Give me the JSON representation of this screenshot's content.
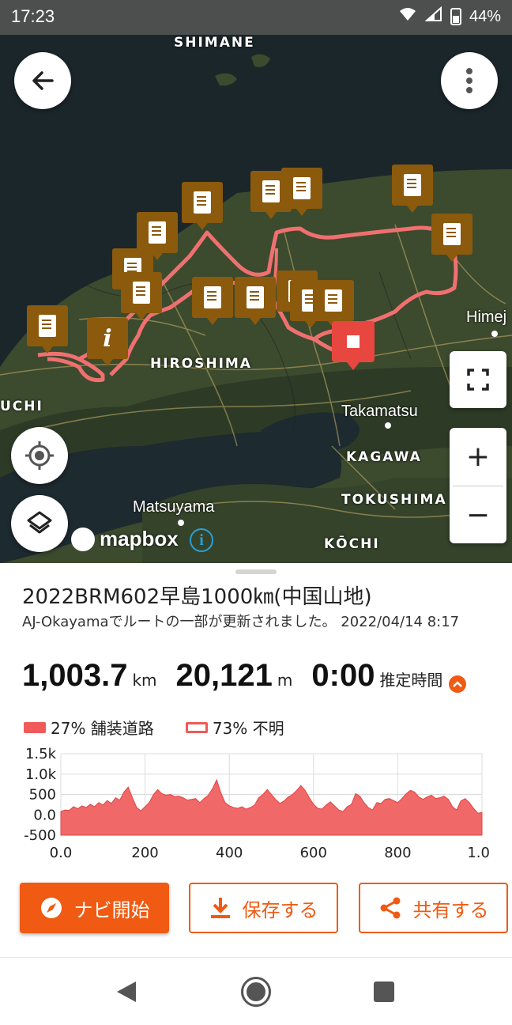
{
  "status_bar": {
    "time": "17:23",
    "battery": "44%"
  },
  "map": {
    "region_labels": {
      "shimane": "SHIMANE",
      "hiroshima": "HIROSHIMA",
      "uchi": "UCHI",
      "kagawa": "KAGAWA",
      "tokushima": "TOKUSHIMA",
      "kochi": "KŌCHI"
    },
    "city_labels": {
      "himeji": "Himej",
      "takamatsu": "Takamatsu",
      "matsuyama": "Matsuyama"
    },
    "attribution": "mapbox",
    "route_color": "#f07070",
    "marker_color": "#8b5a0d",
    "goal_color": "#e8473f",
    "buttons": {
      "zoom_in": "+",
      "zoom_out": "−"
    }
  },
  "route": {
    "title": "2022BRM602早島1000㎞(中国山地)",
    "update_note": "AJ-Okayamaでルートの一部が更新されました。 2022/04/14 8:17",
    "distance_value": "1,003.7",
    "distance_unit": "km",
    "elevation_value": "20,121",
    "elevation_unit": "m",
    "time_value": "0:00",
    "time_label": "推定時間"
  },
  "legend": {
    "paved": "27% 舗装道路",
    "unknown": "73% 不明"
  },
  "chart_data": {
    "type": "area",
    "series": [
      {
        "values": [
          [
            0,
            80
          ],
          [
            10,
            120
          ],
          [
            20,
            110
          ],
          [
            30,
            200
          ],
          [
            40,
            150
          ],
          [
            50,
            220
          ],
          [
            60,
            180
          ],
          [
            70,
            260
          ],
          [
            80,
            200
          ],
          [
            90,
            300
          ],
          [
            100,
            240
          ],
          [
            110,
            350
          ],
          [
            120,
            280
          ],
          [
            130,
            420
          ],
          [
            140,
            360
          ],
          [
            150,
            560
          ],
          [
            160,
            680
          ],
          [
            170,
            420
          ],
          [
            180,
            180
          ],
          [
            190,
            100
          ],
          [
            200,
            200
          ],
          [
            210,
            300
          ],
          [
            220,
            500
          ],
          [
            230,
            620
          ],
          [
            240,
            520
          ],
          [
            250,
            480
          ],
          [
            260,
            500
          ],
          [
            270,
            450
          ],
          [
            280,
            460
          ],
          [
            290,
            420
          ],
          [
            300,
            360
          ],
          [
            310,
            380
          ],
          [
            320,
            400
          ],
          [
            330,
            300
          ],
          [
            340,
            400
          ],
          [
            350,
            480
          ],
          [
            360,
            640
          ],
          [
            370,
            860
          ],
          [
            380,
            540
          ],
          [
            390,
            300
          ],
          [
            400,
            220
          ],
          [
            410,
            180
          ],
          [
            420,
            160
          ],
          [
            430,
            200
          ],
          [
            440,
            140
          ],
          [
            450,
            180
          ],
          [
            460,
            240
          ],
          [
            470,
            420
          ],
          [
            480,
            500
          ],
          [
            490,
            620
          ],
          [
            500,
            500
          ],
          [
            510,
            380
          ],
          [
            520,
            280
          ],
          [
            530,
            340
          ],
          [
            540,
            440
          ],
          [
            550,
            500
          ],
          [
            560,
            600
          ],
          [
            570,
            720
          ],
          [
            580,
            600
          ],
          [
            590,
            420
          ],
          [
            600,
            260
          ],
          [
            610,
            160
          ],
          [
            620,
            140
          ],
          [
            630,
            240
          ],
          [
            640,
            320
          ],
          [
            650,
            220
          ],
          [
            660,
            120
          ],
          [
            670,
            80
          ],
          [
            680,
            200
          ],
          [
            690,
            260
          ],
          [
            700,
            520
          ],
          [
            710,
            460
          ],
          [
            720,
            300
          ],
          [
            730,
            180
          ],
          [
            740,
            120
          ],
          [
            750,
            300
          ],
          [
            760,
            280
          ],
          [
            770,
            380
          ],
          [
            780,
            400
          ],
          [
            790,
            350
          ],
          [
            800,
            300
          ],
          [
            810,
            400
          ],
          [
            820,
            520
          ],
          [
            830,
            600
          ],
          [
            840,
            560
          ],
          [
            850,
            440
          ],
          [
            860,
            380
          ],
          [
            870,
            440
          ],
          [
            880,
            480
          ],
          [
            890,
            400
          ],
          [
            900,
            420
          ],
          [
            910,
            460
          ],
          [
            920,
            380
          ],
          [
            930,
            200
          ],
          [
            940,
            120
          ],
          [
            950,
            340
          ],
          [
            960,
            400
          ],
          [
            970,
            300
          ],
          [
            980,
            160
          ],
          [
            990,
            40
          ],
          [
            1000,
            60
          ]
        ]
      }
    ],
    "x_ticks": [
      "0.0",
      "200",
      "400",
      "600",
      "800",
      "1.0"
    ],
    "y_ticks": [
      "1.5k",
      "1.0k",
      "500",
      "0.0",
      "-500"
    ],
    "xlim": [
      0,
      1000
    ],
    "ylim": [
      -500,
      1500
    ],
    "grid": true,
    "fill_color": "#f06868"
  },
  "actions": {
    "navigate": "ナビ開始",
    "save": "保存する",
    "share": "共有する"
  },
  "accent_color": "#f05a12"
}
